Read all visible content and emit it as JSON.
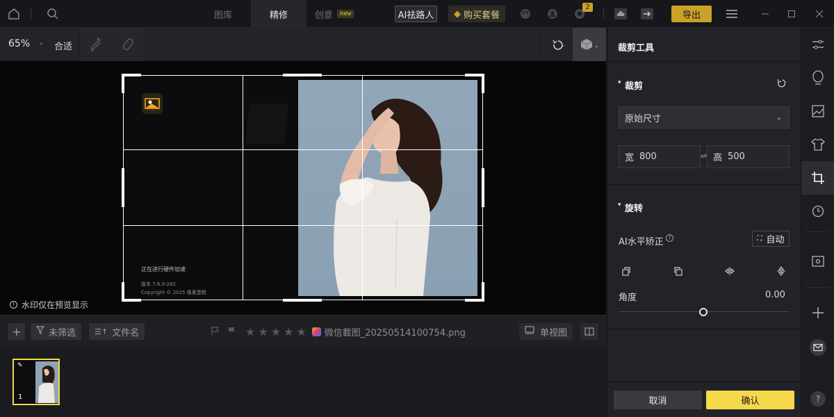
{
  "topbar": {
    "tabs": [
      {
        "label": "图库",
        "active": false
      },
      {
        "label": "精修",
        "active": true
      },
      {
        "label": "创意",
        "active": false,
        "badge": "new"
      }
    ],
    "ai_button": "AI祛路人",
    "buy_button": "购买套餐",
    "notification_count": "2",
    "export_button": "导出"
  },
  "toolbar": {
    "zoom": "65%",
    "fit_label": "合适"
  },
  "canvas": {
    "watermark_notice": "水印仅在预览显示",
    "hw_accel_text": "正在进行硬件加速",
    "version_text": "版本 7.6.0-282",
    "copyright_text": "Copyright © 2025 像素蛋糕"
  },
  "filmbar": {
    "filter_label": "未筛选",
    "sort_label": "文件名",
    "file_name": "微信截图_20250514100754.png",
    "view_label": "单视图",
    "rating": 0
  },
  "film": {
    "items": [
      {
        "index": "1"
      }
    ]
  },
  "panel": {
    "title": "裁剪工具",
    "crop": {
      "section_title": "裁剪",
      "ratio_select": "原始尺寸",
      "width_label": "宽",
      "width_value": "800",
      "height_label": "高",
      "height_value": "500"
    },
    "rotate": {
      "section_title": "旋转",
      "ai_level_label": "AI水平矫正",
      "auto_button": "自动",
      "angle_label": "角度",
      "angle_value": "0.00"
    },
    "cancel_button": "取消",
    "confirm_button": "确认"
  },
  "colors": {
    "accent_yellow": "#f5d94a",
    "export_gold": "#c9a227",
    "sky": "#8ea3b5"
  }
}
